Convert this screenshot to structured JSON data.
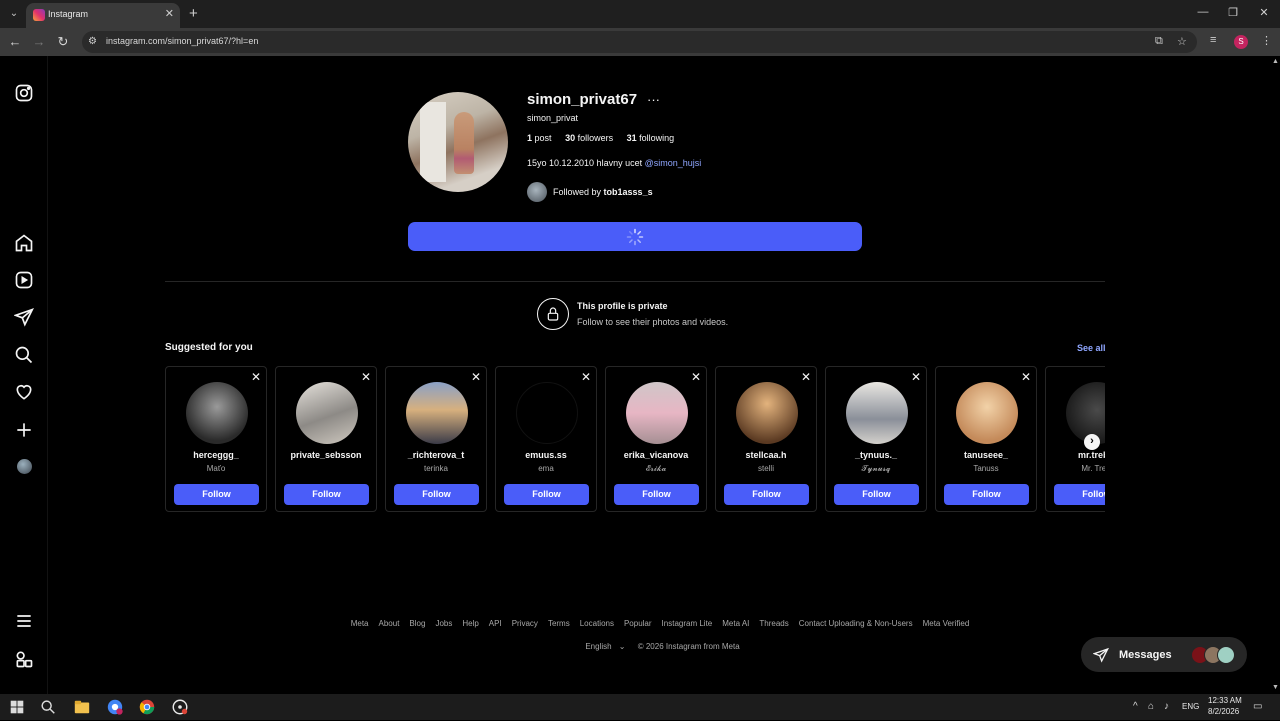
{
  "browser": {
    "tab_title": "Instagram",
    "url": "instagram.com/simon_privat67/?hl=en",
    "profile_initial": "S"
  },
  "profile": {
    "username": "simon_privat67",
    "full_name": "simon_privat",
    "posts_count": "1",
    "posts_label": "post",
    "followers_count": "30",
    "followers_label": "followers",
    "following_count": "31",
    "following_label": "following",
    "bio_text": "15yo 10.12.2010 hlavny ucet",
    "bio_mention": "@simon_hujsi",
    "followed_by_prefix": "Followed by",
    "followed_by_user": "tob1asss_s",
    "follow_button_state": "loading"
  },
  "private_notice": {
    "title": "This profile is private",
    "subtitle": "Follow to see their photos and videos."
  },
  "suggested": {
    "title": "Suggested for you",
    "see_all": "See all",
    "follow_label": "Follow",
    "cards": [
      {
        "username": "herceggg_",
        "name": "Maťo"
      },
      {
        "username": "private_sebsson",
        "name": ""
      },
      {
        "username": "_richterova_t",
        "name": "terinka"
      },
      {
        "username": "emuus.ss",
        "name": "ema"
      },
      {
        "username": "erika_vicanova",
        "name": "𝓔𝓻𝓲𝓴𝓪"
      },
      {
        "username": "stellcaa.h",
        "name": "stelli"
      },
      {
        "username": "_tynuus._",
        "name": "𝓣𝔂𝓷𝓾𝓼𝓺"
      },
      {
        "username": "tanuseee_",
        "name": "Tanuss"
      },
      {
        "username": "mr.trebu",
        "name": "Mr. Treb"
      }
    ]
  },
  "footer": {
    "links": [
      "Meta",
      "About",
      "Blog",
      "Jobs",
      "Help",
      "API",
      "Privacy",
      "Terms",
      "Locations",
      "Popular",
      "Instagram Lite",
      "Meta AI",
      "Threads",
      "Contact Uploading & Non-Users",
      "Meta Verified"
    ],
    "language": "English",
    "copyright": "© 2026 Instagram from Meta"
  },
  "messages": {
    "label": "Messages"
  },
  "taskbar": {
    "language": "ENG",
    "time": "12:33 AM",
    "date": "8/2/2026"
  },
  "colors": {
    "accent": "#4a5df9",
    "link": "#8fa6ff",
    "background": "#000000"
  }
}
